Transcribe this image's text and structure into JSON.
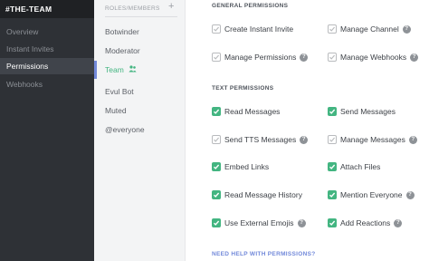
{
  "nav": {
    "server_name": "#THE-TEAM",
    "items": [
      {
        "label": "Overview",
        "active": false
      },
      {
        "label": "Instant Invites",
        "active": false
      },
      {
        "label": "Permissions",
        "active": true
      },
      {
        "label": "Webhooks",
        "active": false
      }
    ]
  },
  "roles": {
    "header": "ROLES/MEMBERS",
    "add_symbol": "+",
    "items": [
      {
        "label": "Botwinder"
      },
      {
        "label": "Moderator"
      },
      {
        "label": "Team",
        "icon": "people-icon"
      },
      {
        "label": "Evul Bot"
      },
      {
        "label": "Muted"
      },
      {
        "label": "@everyone"
      }
    ]
  },
  "general": {
    "title": "GENERAL PERMISSIONS",
    "perms": [
      {
        "label": "Create Instant Invite",
        "checked": false,
        "help": false
      },
      {
        "label": "Manage Channel",
        "checked": false,
        "help": true
      },
      {
        "label": "Manage Permissions",
        "checked": false,
        "help": true
      },
      {
        "label": "Manage Webhooks",
        "checked": false,
        "help": true
      }
    ]
  },
  "text": {
    "title": "TEXT PERMISSIONS",
    "perms": [
      {
        "label": "Read Messages",
        "checked": true,
        "help": false
      },
      {
        "label": "Send Messages",
        "checked": true,
        "help": false
      },
      {
        "label": "Send TTS Messages",
        "checked": false,
        "help": true
      },
      {
        "label": "Manage Messages",
        "checked": false,
        "help": true
      },
      {
        "label": "Embed Links",
        "checked": true,
        "help": false
      },
      {
        "label": "Attach Files",
        "checked": true,
        "help": false
      },
      {
        "label": "Read Message History",
        "checked": true,
        "help": false
      },
      {
        "label": "Mention Everyone",
        "checked": true,
        "help": true
      },
      {
        "label": "Use External Emojis",
        "checked": true,
        "help": true
      },
      {
        "label": "Add Reactions",
        "checked": true,
        "help": true
      }
    ]
  },
  "help_link": "NEED HELP WITH PERMISSIONS?",
  "help_symbol": "?",
  "colors": {
    "accent": "#7289da",
    "checked": "#43b581",
    "sidebar": "#2e3136"
  }
}
